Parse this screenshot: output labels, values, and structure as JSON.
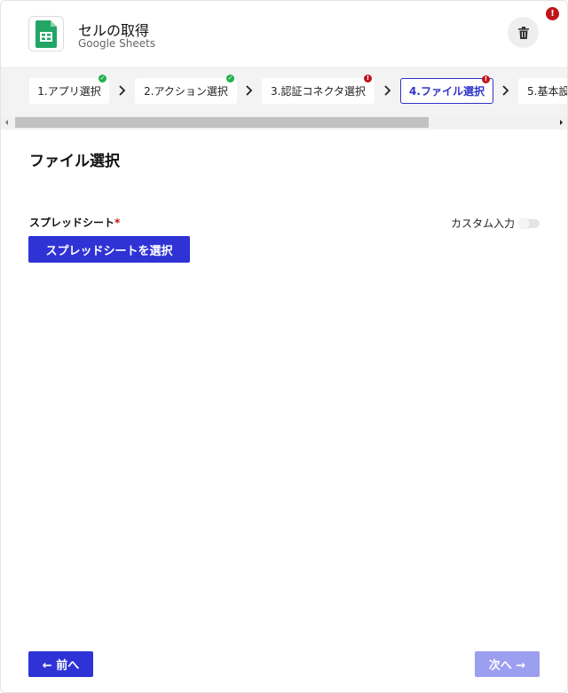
{
  "header": {
    "title": "セルの取得",
    "subtitle": "Google Sheets",
    "app_icon": "google-sheets-icon",
    "delete_icon": "trash-icon",
    "alert_badge": "!"
  },
  "steps": [
    {
      "label": "1.アプリ選択",
      "status": "complete"
    },
    {
      "label": "2.アクション選択",
      "status": "complete"
    },
    {
      "label": "3.認証コネクタ選択",
      "status": "error"
    },
    {
      "label": "4.ファイル選択",
      "status": "error",
      "active": true
    },
    {
      "label": "5.基本設",
      "status": "none"
    }
  ],
  "content": {
    "section_title": "ファイル選択",
    "field_label": "スプレッドシート",
    "required_mark": "*",
    "custom_input_label": "カスタム入力",
    "custom_input_enabled": false,
    "select_button": "スプレッドシートを選択"
  },
  "footer": {
    "prev_label": "← 前へ",
    "next_label": "次へ →",
    "next_enabled": false
  },
  "colors": {
    "primary": "#2f33d6",
    "primary_disabled": "#9c9ef0",
    "error": "#c0151b",
    "success": "#22b14c",
    "sheets_green": "#23a566"
  }
}
